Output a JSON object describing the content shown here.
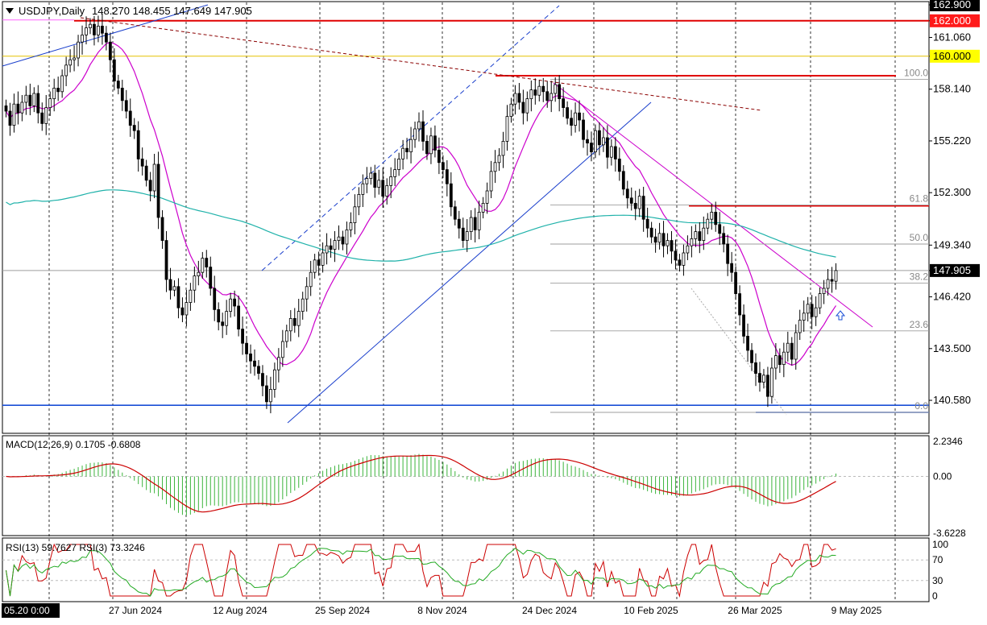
{
  "header": {
    "dropdown_icon": "triangle-down-icon",
    "symbol_label": "USDJPY,Daily",
    "ohlc_text": "148.270 148.455 147.649 147.905"
  },
  "colors": {
    "candle": "#000000",
    "ma_fast": "#cc00cc",
    "ma_slow": "#20b2aa",
    "fib_line": "#9e9e9e",
    "resistance_red": "#e00000",
    "level_yellow": "#e6c200",
    "trend_blue": "#1a3fcc",
    "support_blue": "#1a4fd6",
    "trend_darkred": "#8b0000",
    "macd_hist": "#3cb43c",
    "macd_signal": "#cc0000",
    "rsi_main": "#cc0000",
    "rsi_fast": "#22aa22",
    "current_price_box": "#000000",
    "level_box": "#ffff00"
  },
  "chart_data": [
    {
      "type": "candlestick",
      "title": "USDJPY,Daily",
      "ylim": [
        138.9,
        162.9
      ],
      "y_ticks": [
        {
          "value": 162.9,
          "label": "162.900",
          "style": "dark"
        },
        {
          "value": 162.0,
          "label": "162.000",
          "style": "magenta"
        },
        {
          "value": 161.06,
          "label": "161.060",
          "style": "plain"
        },
        {
          "value": 160.0,
          "label": "160.000",
          "style": "yellow"
        },
        {
          "value": 158.14,
          "label": "158.140",
          "style": "plain"
        },
        {
          "value": 155.22,
          "label": "155.220",
          "style": "plain"
        },
        {
          "value": 152.3,
          "label": "152.300",
          "style": "plain"
        },
        {
          "value": 149.34,
          "label": "149.340",
          "style": "plain"
        },
        {
          "value": 147.905,
          "label": "147.905",
          "style": "dark"
        },
        {
          "value": 146.42,
          "label": "146.420",
          "style": "plain"
        },
        {
          "value": 143.5,
          "label": "143.500",
          "style": "plain"
        },
        {
          "value": 140.58,
          "label": "140.580",
          "style": "plain"
        }
      ],
      "x_ticks": [
        "05.20 0:00",
        "27 Jun 2024",
        "12 Aug 2024",
        "25 Sep 2024",
        "8 Nov 2024",
        "24 Dec 2024",
        "10 Feb 2025",
        "26 Mar 2025",
        "9 May 2025"
      ],
      "fibonacci": {
        "levels": [
          {
            "label": "100.0",
            "value": 158.7
          },
          {
            "label": "61.8",
            "value": 151.6
          },
          {
            "label": "50.0",
            "value": 149.4
          },
          {
            "label": "38.2",
            "value": 147.2
          },
          {
            "label": "23.6",
            "value": 144.5
          },
          {
            "label": "0.0",
            "value": 139.9
          }
        ]
      },
      "horizontal_levels": [
        {
          "name": "resistance-162",
          "value": 162.0
        },
        {
          "name": "level-160",
          "value": 160.0
        },
        {
          "name": "resistance-158.9",
          "value": 158.9
        },
        {
          "name": "resistance-151.5",
          "value": 151.55
        },
        {
          "name": "support-140.2",
          "value": 140.2
        },
        {
          "name": "last-price",
          "value": 147.905
        }
      ],
      "closes": [
        156.9,
        156.1,
        157.3,
        156.8,
        157.4,
        157.8,
        157.2,
        157.9,
        156.8,
        156.2,
        157.1,
        157.6,
        158.2,
        158.0,
        158.9,
        159.5,
        159.8,
        159.9,
        160.8,
        161.2,
        161.6,
        161.8,
        161.2,
        161.7,
        161.3,
        160.8,
        159.8,
        158.6,
        158.2,
        157.5,
        156.9,
        156.1,
        155.8,
        154.2,
        153.8,
        153.0,
        152.4,
        153.9,
        150.9,
        149.6,
        147.4,
        146.8,
        147.0,
        145.8,
        145.4,
        146.1,
        146.8,
        147.6,
        147.8,
        148.6,
        148.1,
        146.9,
        145.7,
        145.0,
        144.8,
        145.6,
        146.3,
        145.9,
        144.6,
        143.8,
        143.2,
        142.8,
        142.5,
        142.1,
        141.4,
        140.5,
        141.2,
        142.3,
        143.0,
        143.9,
        144.5,
        145.2,
        144.8,
        145.6,
        146.3,
        147.0,
        147.8,
        148.5,
        148.2,
        148.9,
        149.3,
        149.1,
        149.6,
        149.8,
        149.4,
        150.2,
        150.6,
        151.5,
        152.2,
        152.8,
        153.1,
        153.4,
        152.6,
        153.0,
        152.1,
        152.7,
        153.2,
        153.6,
        154.2,
        154.8,
        154.6,
        155.3,
        155.9,
        156.3,
        155.2,
        154.5,
        155.5,
        154.7,
        154.0,
        153.6,
        152.8,
        151.5,
        150.8,
        150.3,
        149.6,
        150.1,
        150.9,
        150.2,
        151.2,
        151.7,
        152.4,
        153.5,
        154.0,
        154.4,
        155.2,
        156.6,
        157.3,
        157.9,
        157.4,
        156.8,
        157.6,
        158.1,
        157.8,
        158.3,
        158.0,
        157.5,
        157.9,
        158.4,
        157.6,
        157.1,
        156.5,
        156.1,
        156.8,
        156.4,
        155.3,
        155.1,
        154.6,
        155.8,
        155.0,
        155.4,
        154.3,
        154.9,
        154.2,
        153.5,
        152.5,
        152.0,
        151.7,
        151.4,
        152.1,
        150.8,
        150.3,
        149.8,
        149.5,
        150.0,
        149.3,
        149.6,
        149.0,
        148.5,
        148.2,
        148.9,
        149.3,
        149.7,
        150.1,
        149.6,
        150.3,
        150.8,
        151.2,
        150.5,
        150.0,
        149.4,
        148.3,
        147.8,
        146.6,
        145.4,
        144.2,
        143.4,
        142.7,
        142.1,
        141.6,
        142.0,
        140.8,
        142.4,
        143.1,
        142.6,
        143.3,
        143.8,
        142.9,
        144.4,
        145.1,
        145.5,
        146.0,
        145.3,
        145.8,
        146.6,
        146.9,
        147.4,
        147.3,
        147.905
      ],
      "ma_fast": {
        "label": "MA fast",
        "points_desc": "follows price with lag"
      },
      "ma_slow": {
        "label": "MA slow"
      }
    },
    {
      "type": "bar",
      "title": "MACD(12,26,9) 0.1705 -0.6808",
      "ylim": [
        -3.6228,
        2.2346
      ],
      "y_ticks": [
        {
          "value": 2.2346,
          "label": "2.2346"
        },
        {
          "value": 0.0,
          "label": "0.00"
        },
        {
          "value": -3.6228,
          "label": "-3.6228"
        }
      ],
      "series": [
        {
          "name": "MACD",
          "style": "histogram"
        },
        {
          "name": "Signal",
          "style": "line"
        }
      ]
    },
    {
      "type": "line",
      "title": "RSI(13) 59.7627  RSI(3) 73.3246",
      "ylim": [
        0,
        100
      ],
      "y_ticks": [
        {
          "value": 100,
          "label": "100"
        },
        {
          "value": 70,
          "label": "70"
        },
        {
          "value": 30,
          "label": "30"
        },
        {
          "value": 0,
          "label": "0"
        }
      ],
      "series": [
        {
          "name": "RSI(13)"
        },
        {
          "name": "RSI(3)"
        }
      ]
    }
  ]
}
